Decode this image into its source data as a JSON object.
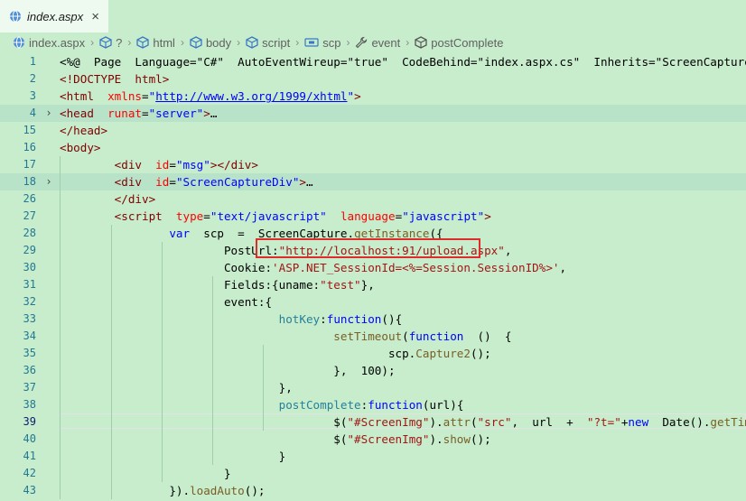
{
  "tab": {
    "label": "index.aspx",
    "close": "×"
  },
  "breadcrumb": {
    "items": [
      "index.aspx",
      "?",
      "html",
      "body",
      "script",
      "scp",
      "event",
      "postComplete"
    ]
  },
  "editor": {
    "lines": [
      {
        "n": "1",
        "active": false,
        "fold": "",
        "tokens": [
          [
            "p",
            "<%@  Page  Language=\"C#\"  AutoEventWireup=\"true\"  CodeBehind=\"index.aspx.cs\"  Inherits=\"ScreenCapturePro.index\""
          ]
        ]
      },
      {
        "n": "2",
        "active": false,
        "fold": "",
        "tokens": [
          [
            "t",
            "<!DOCTYPE  html>"
          ]
        ]
      },
      {
        "n": "3",
        "active": false,
        "fold": "",
        "tokens": [
          [
            "t",
            "<html  "
          ],
          [
            "a",
            "xmlns"
          ],
          [
            "p",
            "="
          ],
          [
            "v",
            "\""
          ],
          [
            "u",
            "http://www.w3.org/1999/xhtml"
          ],
          [
            "v",
            "\""
          ],
          [
            "t",
            ">"
          ]
        ]
      },
      {
        "n": "4",
        "active": false,
        "fold": "›",
        "tokens": [
          [
            "t",
            "<head  "
          ],
          [
            "a",
            "runat"
          ],
          [
            "p",
            "="
          ],
          [
            "v",
            "\"server\""
          ],
          [
            "t",
            ">"
          ],
          [
            "p",
            "…"
          ]
        ]
      },
      {
        "n": "15",
        "active": false,
        "fold": "",
        "tokens": [
          [
            "t",
            "</head>"
          ]
        ]
      },
      {
        "n": "16",
        "active": false,
        "fold": "",
        "tokens": [
          [
            "t",
            "<body>"
          ]
        ]
      },
      {
        "n": "17",
        "active": false,
        "fold": "",
        "tokens": [
          [
            "p",
            "        "
          ],
          [
            "t",
            "<div  "
          ],
          [
            "a",
            "id"
          ],
          [
            "p",
            "="
          ],
          [
            "v",
            "\"msg\""
          ],
          [
            "t",
            "></div>"
          ]
        ]
      },
      {
        "n": "18",
        "active": false,
        "fold": "›",
        "tokens": [
          [
            "p",
            "        "
          ],
          [
            "t",
            "<div  "
          ],
          [
            "a",
            "id"
          ],
          [
            "p",
            "="
          ],
          [
            "v",
            "\"ScreenCaptureDiv\""
          ],
          [
            "t",
            ">"
          ],
          [
            "p",
            "…"
          ]
        ]
      },
      {
        "n": "26",
        "active": false,
        "fold": "",
        "tokens": [
          [
            "p",
            "        "
          ],
          [
            "t",
            "</div>"
          ]
        ]
      },
      {
        "n": "27",
        "active": false,
        "fold": "",
        "tokens": [
          [
            "p",
            "        "
          ],
          [
            "t",
            "<script  "
          ],
          [
            "a",
            "type"
          ],
          [
            "p",
            "="
          ],
          [
            "v",
            "\"text/javascript\""
          ],
          [
            "p",
            "  "
          ],
          [
            "a",
            "language"
          ],
          [
            "p",
            "="
          ],
          [
            "v",
            "\"javascript\""
          ],
          [
            "t",
            ">"
          ]
        ]
      },
      {
        "n": "28",
        "active": false,
        "fold": "",
        "tokens": [
          [
            "p",
            "                "
          ],
          [
            "k",
            "var"
          ],
          [
            "p",
            "  scp  =  ScreenCapture."
          ],
          [
            "f",
            "getInstance"
          ],
          [
            "p",
            "({"
          ]
        ]
      },
      {
        "n": "29",
        "active": false,
        "fold": "",
        "tokens": [
          [
            "p",
            "                        PostUrl:"
          ],
          [
            "s",
            "\"http://localhost:91/upload.aspx\""
          ],
          [
            "p",
            ","
          ]
        ]
      },
      {
        "n": "30",
        "active": false,
        "fold": "",
        "tokens": [
          [
            "p",
            "                        Cookie:"
          ],
          [
            "s",
            "'ASP.NET_SessionId=<%=Session.SessionID%>'"
          ],
          [
            "p",
            ","
          ]
        ]
      },
      {
        "n": "31",
        "active": false,
        "fold": "",
        "tokens": [
          [
            "p",
            "                        Fields:{uname:"
          ],
          [
            "s",
            "\"test\""
          ],
          [
            "p",
            "},"
          ]
        ]
      },
      {
        "n": "32",
        "active": false,
        "fold": "",
        "tokens": [
          [
            "p",
            "                        event:{"
          ]
        ]
      },
      {
        "n": "33",
        "active": false,
        "fold": "",
        "tokens": [
          [
            "p",
            "                                "
          ],
          [
            "d",
            "hotKey"
          ],
          [
            "p",
            ":"
          ],
          [
            "k",
            "function"
          ],
          [
            "p",
            "(){"
          ]
        ]
      },
      {
        "n": "34",
        "active": false,
        "fold": "",
        "tokens": [
          [
            "p",
            "                                        "
          ],
          [
            "f",
            "setTimeout"
          ],
          [
            "p",
            "("
          ],
          [
            "k",
            "function"
          ],
          [
            "p",
            "  ()  {"
          ]
        ]
      },
      {
        "n": "35",
        "active": false,
        "fold": "",
        "tokens": [
          [
            "p",
            "                                                scp."
          ],
          [
            "f",
            "Capture2"
          ],
          [
            "p",
            "();"
          ]
        ]
      },
      {
        "n": "36",
        "active": false,
        "fold": "",
        "tokens": [
          [
            "p",
            "                                        },  100);"
          ]
        ]
      },
      {
        "n": "37",
        "active": false,
        "fold": "",
        "tokens": [
          [
            "p",
            "                                },"
          ]
        ]
      },
      {
        "n": "38",
        "active": false,
        "fold": "",
        "tokens": [
          [
            "p",
            "                                "
          ],
          [
            "d",
            "postComplete"
          ],
          [
            "p",
            ":"
          ],
          [
            "k",
            "function"
          ],
          [
            "p",
            "(url){"
          ]
        ]
      },
      {
        "n": "39",
        "active": true,
        "fold": "",
        "tokens": [
          [
            "p",
            "                                        $("
          ],
          [
            "s",
            "\"#ScreenImg\""
          ],
          [
            "p",
            ")."
          ],
          [
            "f",
            "attr"
          ],
          [
            "p",
            "("
          ],
          [
            "s",
            "\"src\""
          ],
          [
            "p",
            ",  url  +  "
          ],
          [
            "s",
            "\"?t=\""
          ],
          [
            "p",
            "+"
          ],
          [
            "k",
            "new"
          ],
          [
            "p",
            "  Date()."
          ],
          [
            "f",
            "getTime"
          ],
          [
            "p",
            "()  );"
          ]
        ]
      },
      {
        "n": "40",
        "active": false,
        "fold": "",
        "tokens": [
          [
            "p",
            "                                        $("
          ],
          [
            "s",
            "\"#ScreenImg\""
          ],
          [
            "p",
            ")."
          ],
          [
            "f",
            "show"
          ],
          [
            "p",
            "();"
          ]
        ]
      },
      {
        "n": "41",
        "active": false,
        "fold": "",
        "tokens": [
          [
            "p",
            "                                }"
          ]
        ]
      },
      {
        "n": "42",
        "active": false,
        "fold": "",
        "tokens": [
          [
            "p",
            "                        }"
          ]
        ]
      },
      {
        "n": "43",
        "active": false,
        "fold": "",
        "tokens": [
          [
            "p",
            "                })."
          ],
          [
            "f",
            "loadAuto"
          ],
          [
            "p",
            "();"
          ]
        ]
      }
    ]
  }
}
